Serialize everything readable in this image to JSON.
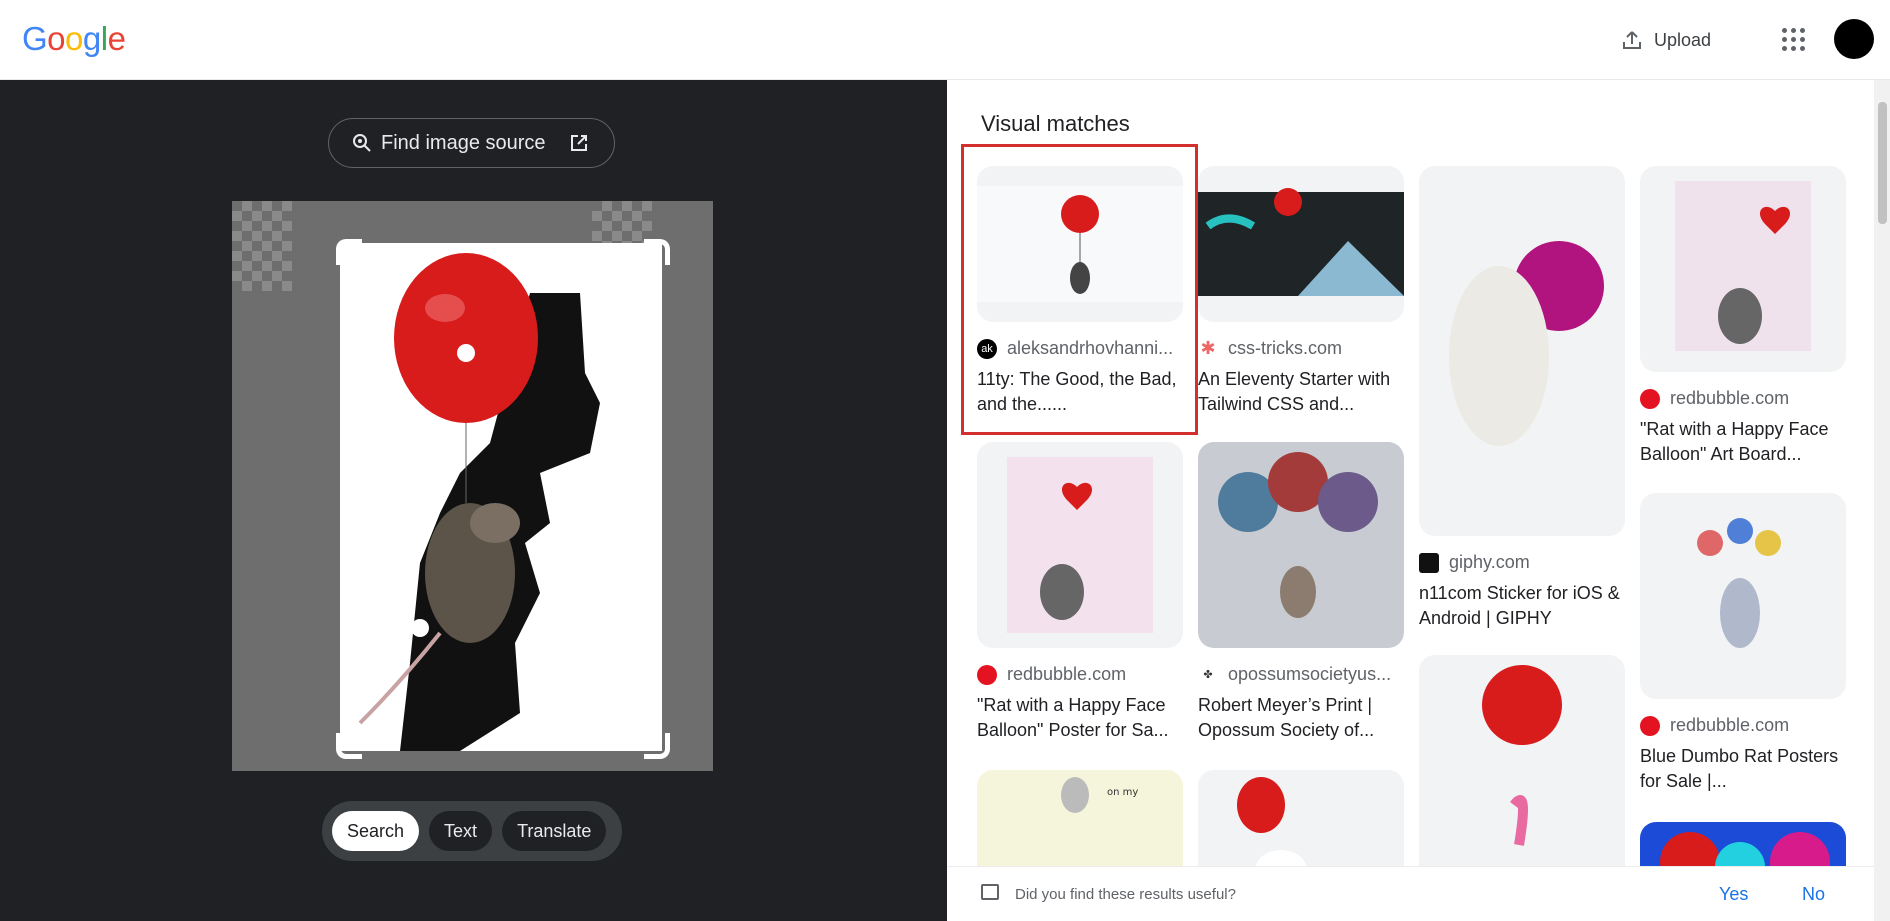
{
  "header": {
    "logo": [
      "G",
      "o",
      "o",
      "g",
      "l",
      "e"
    ],
    "logo_colors": [
      "#4285F4",
      "#EA4335",
      "#FBBC05",
      "#4285F4",
      "#34A853",
      "#EA4335"
    ],
    "upload_label": "Upload"
  },
  "left": {
    "find_source_label": "Find image source",
    "tabs": [
      "Search",
      "Text",
      "Translate"
    ],
    "active_tab": "Search"
  },
  "right": {
    "title": "Visual matches",
    "results": [
      {
        "source": "aleksandrhovhanni...",
        "title": "11ty: The Good, the Bad, and the......",
        "favicon": "alek-avatar-icon"
      },
      {
        "source": "css-tricks.com",
        "title": "An Eleventy Starter with Tailwind CSS and...",
        "favicon": "css-tricks-asterisk-icon"
      },
      {
        "source": "giphy.com",
        "title": "n11com Sticker for iOS & Android | GIPHY",
        "favicon": "giphy-icon"
      },
      {
        "source": "redbubble.com",
        "title": "\"Rat with a Happy Face Balloon\" Art Board...",
        "favicon": "redbubble-icon"
      },
      {
        "source": "redbubble.com",
        "title": "\"Rat with a Happy Face Balloon\" Poster for Sa...",
        "favicon": "redbubble-icon"
      },
      {
        "source": "opossumsocietyus...",
        "title": "Robert Meyer’s Print | Opossum Society of...",
        "favicon": "opossum-icon"
      },
      {
        "source": "redbubble.com",
        "title": "Blue Dumbo Rat Posters for Sale |...",
        "favicon": "redbubble-icon"
      }
    ],
    "feedback": {
      "question": "Did you find these results useful?",
      "yes": "Yes",
      "no": "No"
    }
  },
  "colors": {
    "highlight": "#d32f2f",
    "link": "#1a73e8",
    "dark_panel": "#202124"
  }
}
